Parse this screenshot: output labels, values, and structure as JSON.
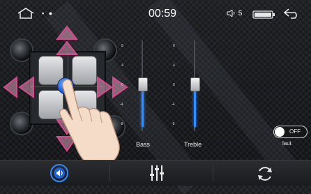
{
  "status_bar": {
    "notification_icons": "▪ ●",
    "time": "00:59",
    "volume_level": "5"
  },
  "seat_balance": {
    "tick_labels_top": [
      "8",
      "4",
      "0",
      "-4",
      "-8"
    ]
  },
  "equalizer": {
    "scale_ticks": [
      "8",
      "4",
      "0",
      "-4",
      "-8"
    ],
    "bands": [
      {
        "label": "Bass",
        "value": 0
      },
      {
        "label": "Treble",
        "value": 0
      }
    ]
  },
  "loudness": {
    "state": "OFF",
    "caption": "laut"
  },
  "bottom_bar": {
    "tabs": [
      "audio-settings",
      "equalizer",
      "reset"
    ]
  },
  "colors": {
    "accent_blue": "#2f8bff",
    "arrow_pink": "#d44a8c"
  }
}
